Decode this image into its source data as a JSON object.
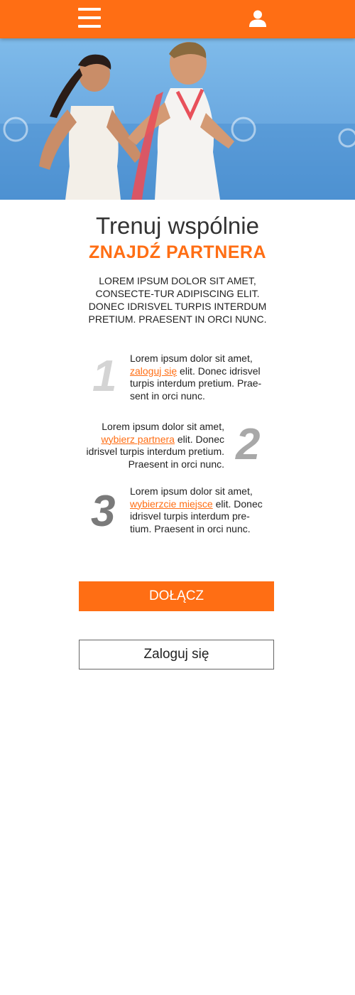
{
  "header": {
    "menu_icon": "hamburger-menu-icon",
    "user_icon": "user-icon",
    "background_color": "#ff6e14"
  },
  "hero": {
    "image": "couple-running-by-sea-photo"
  },
  "main": {
    "title": "Trenuj wspólnie",
    "subtitle": "ZNAJDŹ PARTNERA",
    "intro": "LOREM IPSUM DOLOR SIT AMET, CONSECTE-TUR ADIPISCING ELIT. DONEC IDRISVEL TURPIS INTERDUM PRETIUM. PRAESENT IN ORCI NUNC."
  },
  "steps": [
    {
      "number": "1",
      "before": "Lorem ipsum dolor sit amet, ",
      "link": "zaloguj się",
      "after": " elit. Donec idrisvel turpis interdum pretium. Prae-sent in orci nunc."
    },
    {
      "number": "2",
      "before": "Lorem ipsum dolor sit amet, ",
      "link": "wybierz partnera",
      "after": " elit. Donec idrisvel turpis interdum pretium. Praesent in orci nunc."
    },
    {
      "number": "3",
      "before": "Lorem ipsum dolor sit amet, ",
      "link": "wybierzcie miejsce",
      "after": " elit. Donec idrisvel turpis interdum pre-tium. Praesent in orci nunc."
    }
  ],
  "buttons": {
    "join_label": "DOŁĄCZ",
    "login_label": "Zaloguj się"
  },
  "colors": {
    "accent": "#ff6e14",
    "step1_number": "#d4d4d4",
    "step2_number": "#a8a8a8",
    "step3_number": "#7a7a7a"
  }
}
